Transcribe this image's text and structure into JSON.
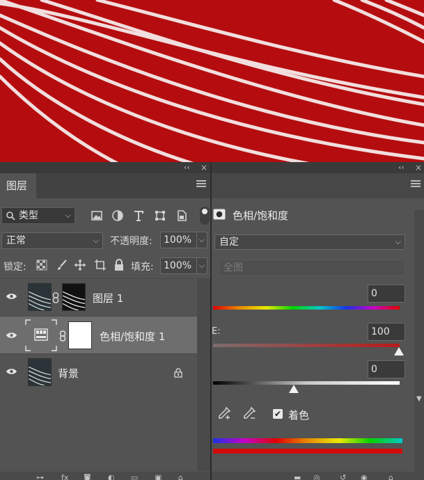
{
  "colors": {
    "canvas_red": "#b50d0f",
    "panel_bg": "#535353",
    "selected_row": "#6e6e6e"
  },
  "layers_panel": {
    "collapse_glyph": "‹‹",
    "close_glyph": "×",
    "tab_label": "图层",
    "filter": {
      "label": "类型",
      "icon": "search-icon"
    },
    "filter_icons": [
      "image-icon",
      "adjustment-circle-icon",
      "type-icon",
      "transform-icon",
      "smart-object-icon",
      "toggle-dot-icon"
    ],
    "blend_mode": "正常",
    "opacity_label": "不透明度:",
    "opacity_value": "100%",
    "lock_label": "锁定:",
    "lock_icons": [
      "lock-transparent-icon",
      "lock-brush-icon",
      "lock-move-icon",
      "lock-artboard-icon",
      "lock-all-icon"
    ],
    "fill_label": "填充:",
    "fill_value": "100%",
    "layers": [
      {
        "name": "图层 1",
        "selected": false
      },
      {
        "name": "色相/饱和度 1",
        "selected": true
      },
      {
        "name": "背景",
        "selected": false,
        "locked": true
      }
    ]
  },
  "properties_panel": {
    "collapse_glyph": "‹‹",
    "close_glyph": "×",
    "title": "色相/饱和度",
    "preset": "自定",
    "channel": "全图",
    "hue_value": "0",
    "saturation_label": "E:",
    "saturation_value": "100",
    "lightness_value": "0",
    "colorize_label": "着色",
    "colorize_checked": true,
    "hue_level": 0,
    "saturation_level": 100,
    "lightness_level": 0
  }
}
